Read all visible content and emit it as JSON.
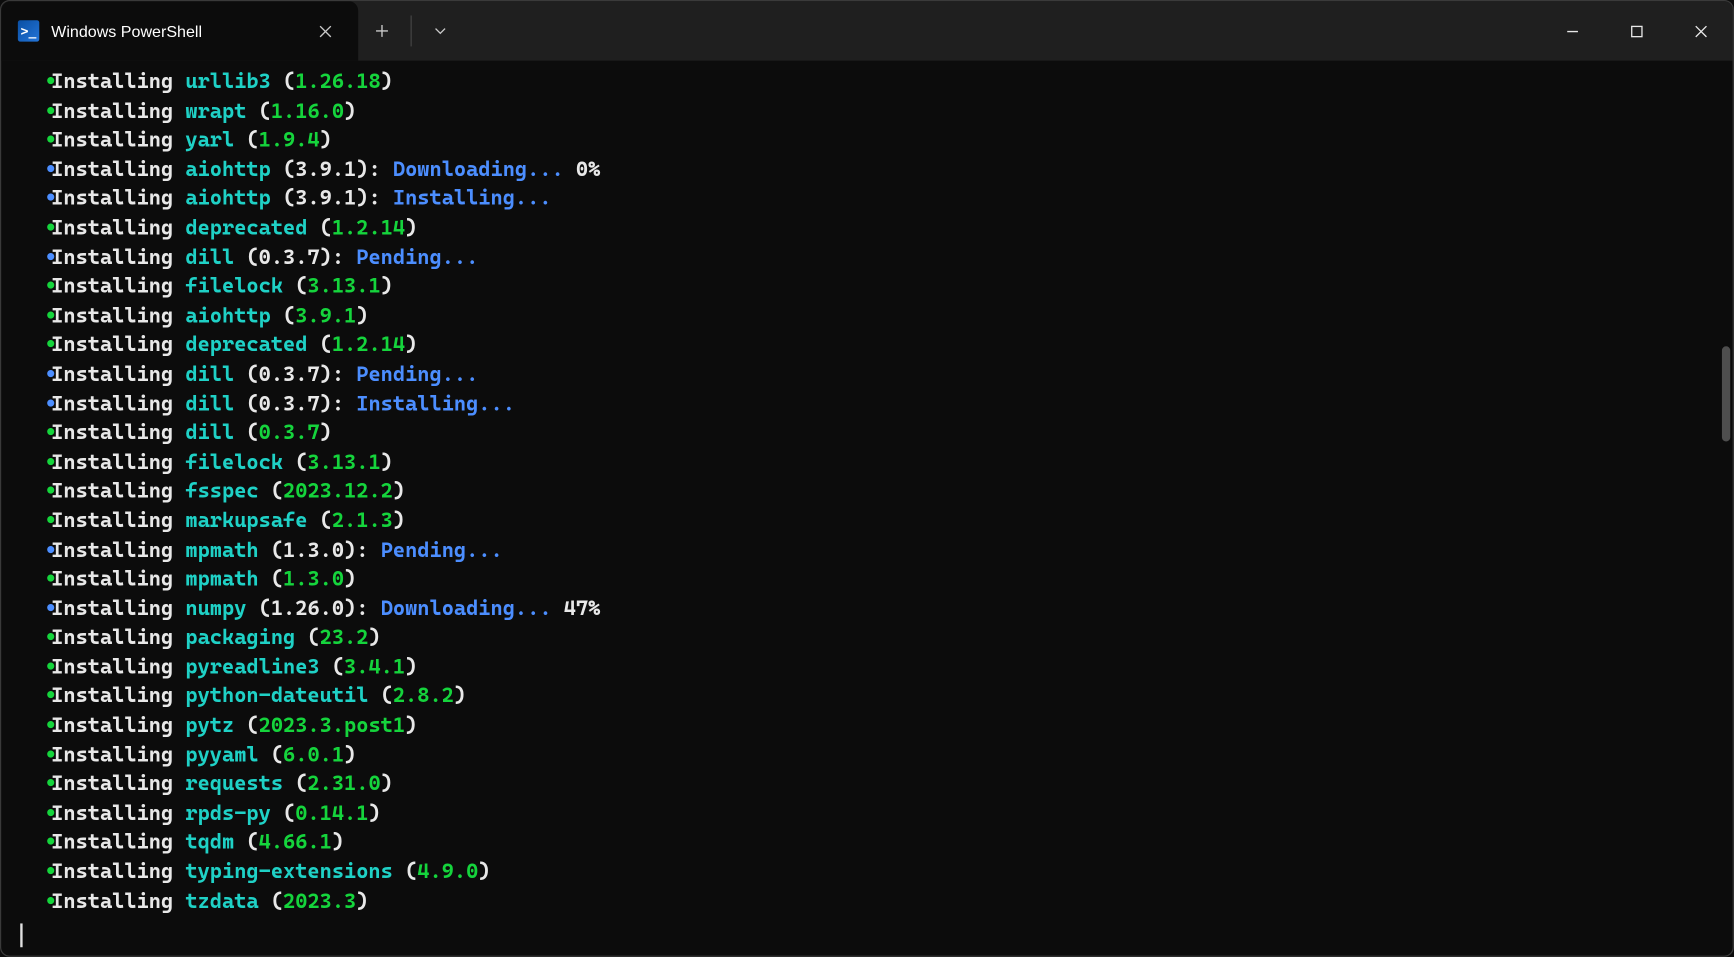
{
  "window": {
    "tab_title": "Windows PowerShell",
    "tab_icon_glyph": ">_"
  },
  "labels": {
    "installing": "Installing",
    "downloading": "Downloading...",
    "pending": "Pending...",
    "installing_status": "Installing..."
  },
  "lines": [
    {
      "bullet": "green",
      "pkg": "urllib3",
      "ver": "1.26.18",
      "done": true
    },
    {
      "bullet": "green",
      "pkg": "wrapt",
      "ver": "1.16.0",
      "done": true
    },
    {
      "bullet": "green",
      "pkg": "yarl",
      "ver": "1.9.4",
      "done": true
    },
    {
      "bullet": "blue",
      "pkg": "aiohttp",
      "ver": "3.9.1",
      "status": "Downloading...",
      "extra": "0%"
    },
    {
      "bullet": "blue",
      "pkg": "aiohttp",
      "ver": "3.9.1",
      "status": "Installing..."
    },
    {
      "bullet": "green",
      "pkg": "deprecated",
      "ver": "1.2.14",
      "done": true
    },
    {
      "bullet": "blue",
      "pkg": "dill",
      "ver": "0.3.7",
      "status": "Pending..."
    },
    {
      "bullet": "green",
      "pkg": "filelock",
      "ver": "3.13.1",
      "done": true
    },
    {
      "bullet": "green",
      "pkg": "aiohttp",
      "ver": "3.9.1",
      "done": true
    },
    {
      "bullet": "green",
      "pkg": "deprecated",
      "ver": "1.2.14",
      "done": true
    },
    {
      "bullet": "blue",
      "pkg": "dill",
      "ver": "0.3.7",
      "status": "Pending..."
    },
    {
      "bullet": "blue",
      "pkg": "dill",
      "ver": "0.3.7",
      "status": "Installing..."
    },
    {
      "bullet": "green",
      "pkg": "dill",
      "ver": "0.3.7",
      "done": true
    },
    {
      "bullet": "green",
      "pkg": "filelock",
      "ver": "3.13.1",
      "done": true
    },
    {
      "bullet": "green",
      "pkg": "fsspec",
      "ver": "2023.12.2",
      "done": true
    },
    {
      "bullet": "green",
      "pkg": "markupsafe",
      "ver": "2.1.3",
      "done": true
    },
    {
      "bullet": "blue",
      "pkg": "mpmath",
      "ver": "1.3.0",
      "status": "Pending..."
    },
    {
      "bullet": "green",
      "pkg": "mpmath",
      "ver": "1.3.0",
      "done": true
    },
    {
      "bullet": "blue",
      "pkg": "numpy",
      "ver": "1.26.0",
      "status": "Downloading...",
      "extra": "47%"
    },
    {
      "bullet": "green",
      "pkg": "packaging",
      "ver": "23.2",
      "done": true
    },
    {
      "bullet": "green",
      "pkg": "pyreadline3",
      "ver": "3.4.1",
      "done": true
    },
    {
      "bullet": "green",
      "pkg": "python-dateutil",
      "ver": "2.8.2",
      "done": true
    },
    {
      "bullet": "green",
      "pkg": "pytz",
      "ver": "2023.3.post1",
      "done": true
    },
    {
      "bullet": "green",
      "pkg": "pyyaml",
      "ver": "6.0.1",
      "done": true
    },
    {
      "bullet": "green",
      "pkg": "requests",
      "ver": "2.31.0",
      "done": true
    },
    {
      "bullet": "green",
      "pkg": "rpds-py",
      "ver": "0.14.1",
      "done": true
    },
    {
      "bullet": "green",
      "pkg": "tqdm",
      "ver": "4.66.1",
      "done": true
    },
    {
      "bullet": "green",
      "pkg": "typing-extensions",
      "ver": "4.9.0",
      "done": true
    },
    {
      "bullet": "green",
      "pkg": "tzdata",
      "ver": "2023.3",
      "done": true
    }
  ]
}
